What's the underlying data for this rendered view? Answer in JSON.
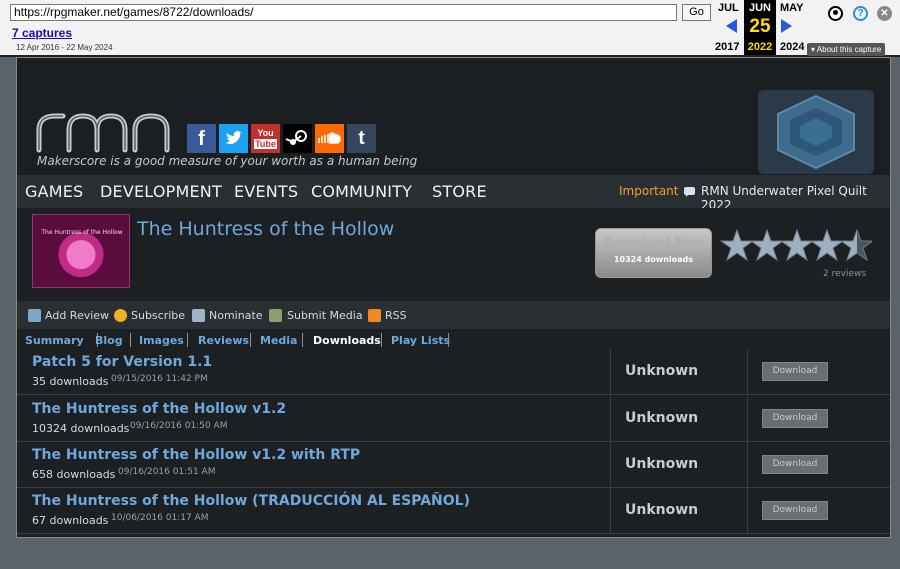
{
  "wayback": {
    "url": "https://rpgmaker.net/games/8722/downloads/",
    "go_label": "Go",
    "captures_link": "7 captures",
    "date_range": "12 Apr 2016 - 22 May 2024",
    "prev_month": "JUL",
    "prev_year": "2017",
    "current_month": "JUN",
    "current_day": "25",
    "current_year": "2022",
    "next_month": "MAY",
    "next_year": "2024",
    "about_label": "About this capture"
  },
  "site": {
    "tagline": "Makerscore is a good measure of your worth as a human being",
    "social": [
      "facebook-icon",
      "twitter-icon",
      "youtube-icon",
      "steam-icon",
      "soundcloud-icon",
      "tumblr-icon"
    ],
    "nav": [
      "GAMES",
      "DEVELOPMENT",
      "EVENTS",
      "COMMUNITY",
      "STORE"
    ],
    "important_label": "Important",
    "news_link": "RMN Underwater Pixel Quilt 2022"
  },
  "game": {
    "title": "The Huntress of the Hollow",
    "thumb_text": "The Huntress of the Hollow",
    "download_now": "Download Now",
    "downloads_count": "10324 downloads",
    "rating_stars": 4.5,
    "reviews": "2 reviews"
  },
  "actions": [
    "Add Review",
    "Subscribe",
    "Nominate",
    "Submit Media",
    "RSS"
  ],
  "tabs": [
    "Summary",
    "Blog",
    "Images",
    "Reviews",
    "Media",
    "Downloads",
    "Play Lists"
  ],
  "active_tab": "Downloads",
  "downloads": [
    {
      "name": "Patch 5 for Version 1.1",
      "count": "35 downloads",
      "date": "09/15/2016 11:42 PM",
      "platform": "Unknown",
      "button": "Download"
    },
    {
      "name": "The Huntress of the Hollow v1.2",
      "count": "10324 downloads",
      "date": "09/16/2016 01:50 AM",
      "platform": "Unknown",
      "button": "Download"
    },
    {
      "name": "The Huntress of the Hollow v1.2 with RTP",
      "count": "658 downloads",
      "date": "09/16/2016 01:51 AM",
      "platform": "Unknown",
      "button": "Download"
    },
    {
      "name": "The Huntress of the Hollow (TRADUCCIÓN AL ESPAÑOL)",
      "count": "67 downloads",
      "date": "10/06/2016 01:17 AM",
      "platform": "Unknown",
      "button": "Download"
    }
  ],
  "colors": {
    "link": "#6fa8dc",
    "important": "#f0a030",
    "wayback_accent": "#ffde00"
  }
}
